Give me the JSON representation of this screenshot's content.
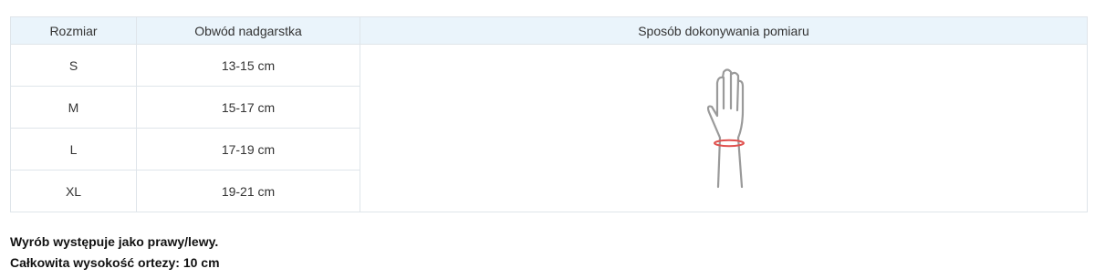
{
  "table": {
    "headers": {
      "size": "Rozmiar",
      "wrist": "Obwód nadgarstka",
      "method": "Sposób dokonywania pomiaru"
    },
    "rows": [
      {
        "size": "S",
        "wrist": "13-15 cm"
      },
      {
        "size": "M",
        "wrist": "15-17 cm"
      },
      {
        "size": "L",
        "wrist": "17-19 cm"
      },
      {
        "size": "XL",
        "wrist": "19-21 cm"
      }
    ],
    "diagram_icon": "hand-wrist-measurement-icon",
    "measure_line_color": "#e0524f",
    "outline_color": "#9a9a9a"
  },
  "notes": {
    "line1": "Wyrób występuje jako prawy/lewy.",
    "line2": "Całkowita wysokość ortezy: 10 cm"
  }
}
